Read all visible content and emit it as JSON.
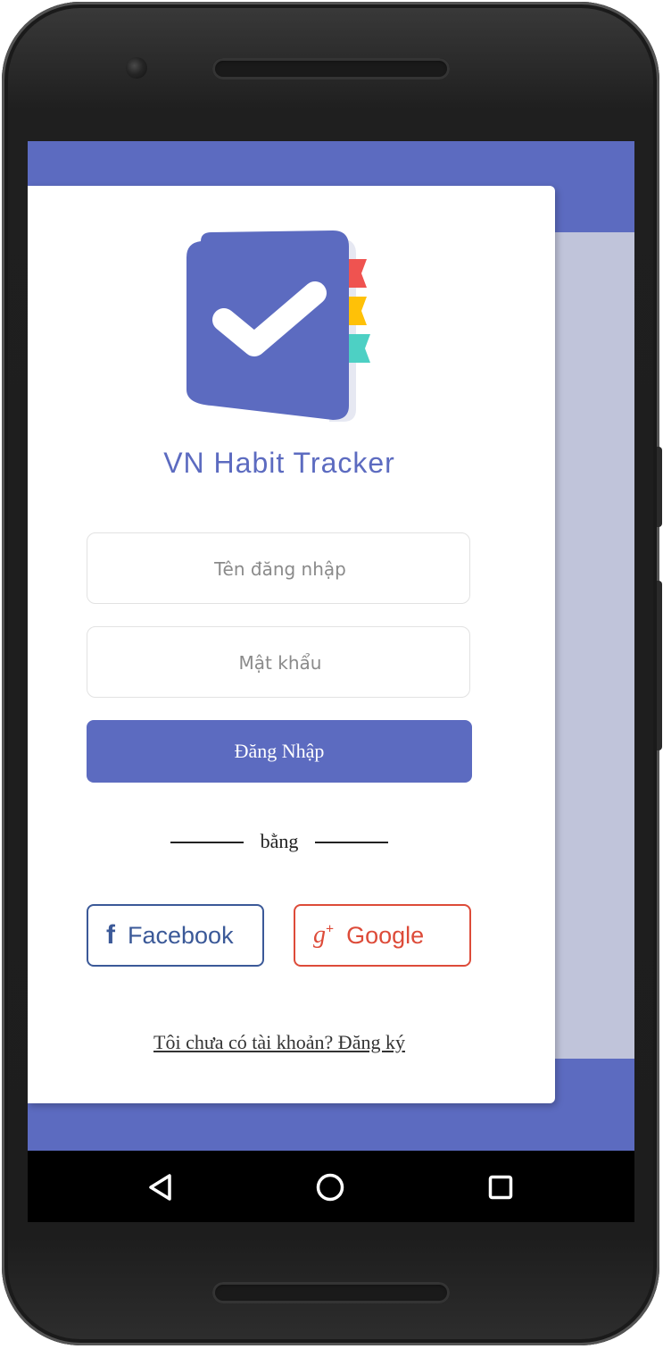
{
  "app": {
    "name": "VN Habit Tracker",
    "brand_color": "#5c6bc0"
  },
  "form": {
    "username_placeholder": "Tên đăng nhập",
    "password_placeholder": "Mật khẩu",
    "login_label": "Đăng Nhập"
  },
  "divider": {
    "text": "bằng"
  },
  "social": {
    "facebook_label": "Facebook",
    "facebook_icon": "facebook-icon",
    "facebook_color": "#3b5998",
    "google_label": "Google",
    "google_icon": "google-plus-icon",
    "google_color": "#dd4b39"
  },
  "register": {
    "text": "Tôi chưa có tài khoản? Đăng ký"
  },
  "navbar": {
    "icons": [
      "back-triangle-icon",
      "home-circle-icon",
      "recents-square-icon"
    ]
  }
}
